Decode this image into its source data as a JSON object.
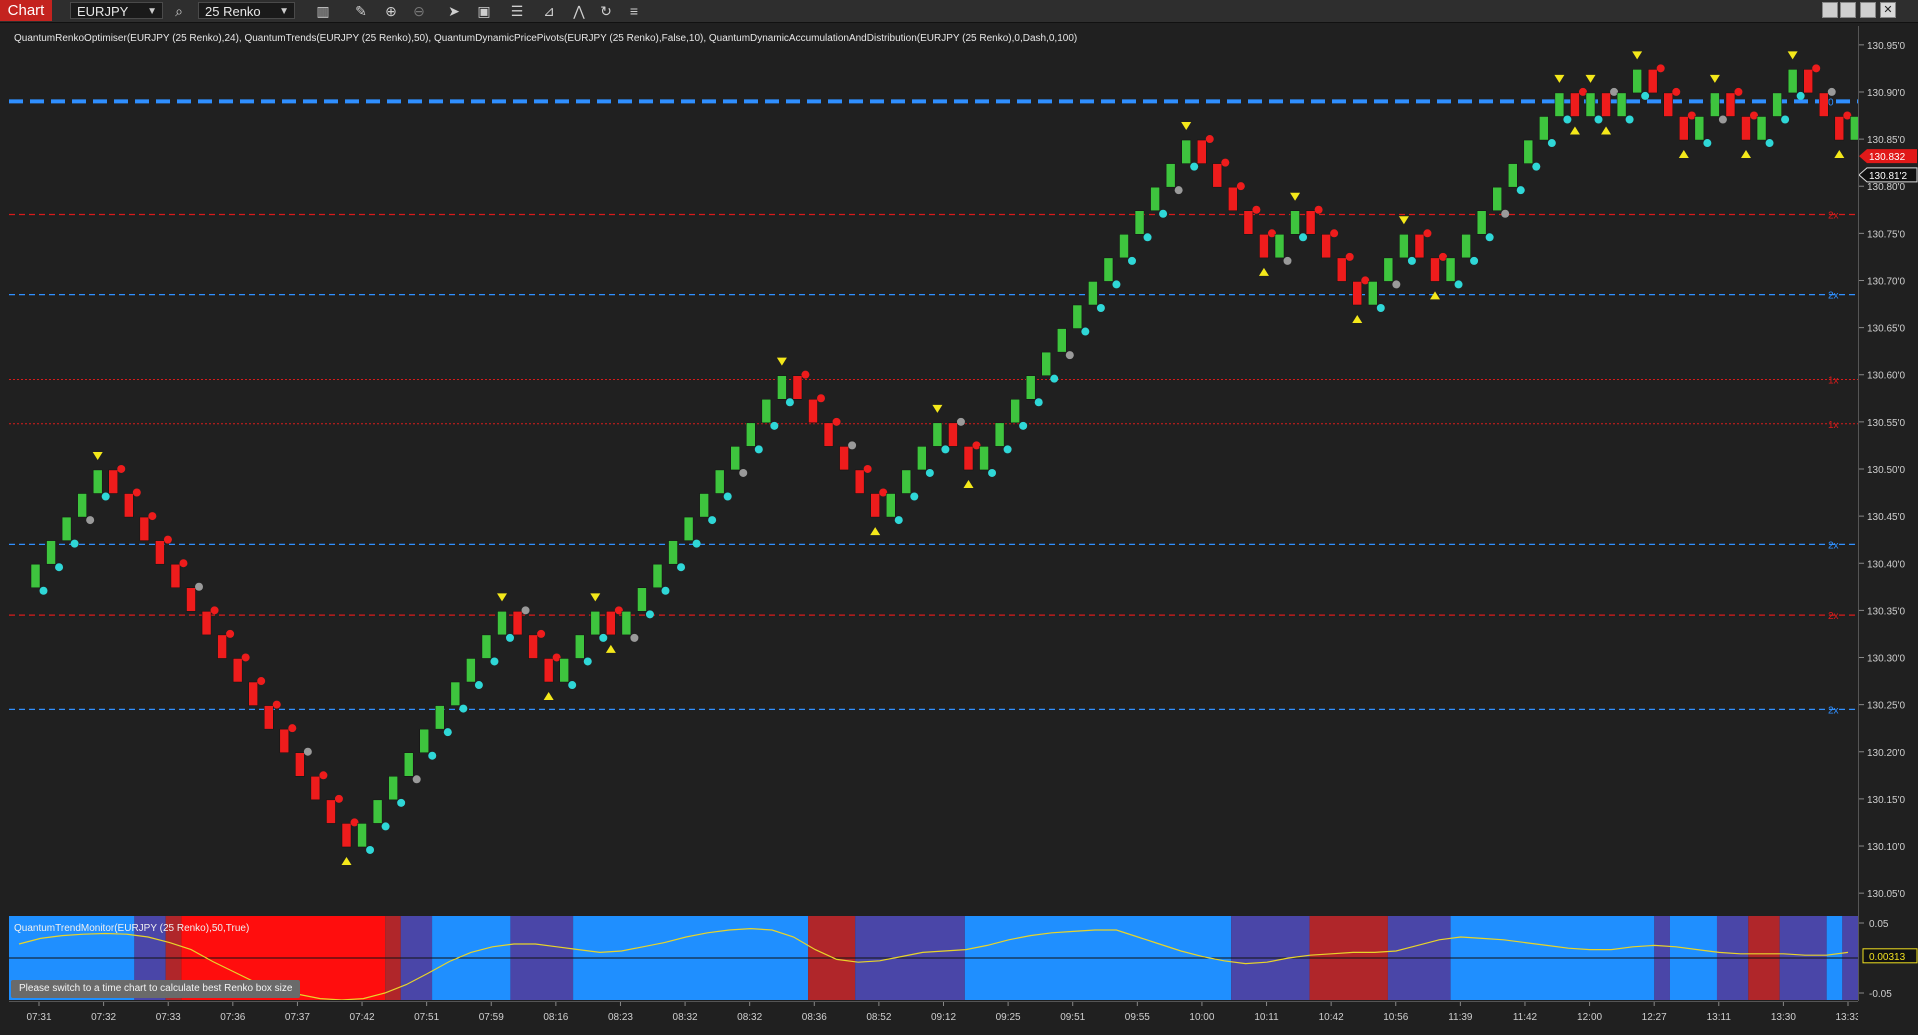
{
  "toolbar": {
    "chart_tab": "Chart",
    "symbol": "EURJPY",
    "bar_type": "25 Renko",
    "icons": [
      "search-icon",
      "bar-style-icon",
      "pencil-icon",
      "zoom-in-icon",
      "zoom-out-icon",
      "cursor-icon",
      "properties-icon",
      "strategy-icon",
      "indicators-icon",
      "drawing-tools-icon",
      "refresh-icon",
      "list-icon"
    ]
  },
  "window_buttons": [
    "minimize-icon",
    "restore-icon",
    "maximize-icon",
    "close-icon"
  ],
  "indicators_label": "QuantumRenkoOptimiser(EURJPY (25 Renko),24), QuantumTrends(EURJPY (25 Renko),50), QuantumDynamicPricePivots(EURJPY (25 Renko),False,10), QuantumDynamicAccumulationAndDistribution(EURJPY (25 Renko),0,Dash,0,100)",
  "oscillator_label": "QuantumTrendMonitor(EURJPY (25 Renko),50,True)",
  "notice": "Please switch to a time chart to calculate best Renko box size",
  "price_axis": {
    "ticks": [
      "130.95'0",
      "130.90'0",
      "130.85'0",
      "130.80'0",
      "130.75'0",
      "130.70'0",
      "130.65'0",
      "130.60'0",
      "130.55'0",
      "130.50'0",
      "130.45'0",
      "130.40'0",
      "130.35'0",
      "130.30'0",
      "130.25'0",
      "130.20'0",
      "130.15'0",
      "130.10'0",
      "130.05'0"
    ],
    "current_price": "130.832",
    "last_price": "130.81'2"
  },
  "osc_axis": {
    "ticks": [
      "0.05",
      "-0.05"
    ],
    "value": "0.00313"
  },
  "time_axis": [
    "07:31",
    "07:32",
    "07:33",
    "07:36",
    "07:37",
    "07:42",
    "07:51",
    "07:59",
    "08:16",
    "08:23",
    "08:32",
    "08:32",
    "08:36",
    "08:52",
    "09:12",
    "09:25",
    "09:51",
    "09:55",
    "10:00",
    "10:11",
    "10:42",
    "10:56",
    "11:39",
    "11:42",
    "12:00",
    "12:27",
    "13:11",
    "13:30",
    "13:33"
  ],
  "level_labels": {
    "blue_major": "0",
    "red_2x": "2x",
    "blue_2x": "2x",
    "red_1x": "1x"
  },
  "colors": {
    "up": "#3ec43e",
    "down": "#ee1c1c",
    "blue_line": "#2f8fff",
    "red_line": "#d81b1b",
    "pivot": "#f4e81a",
    "cyan": "#2fd7d7",
    "gray": "#9a9a9a"
  },
  "chart_data": {
    "type": "renko",
    "box_size": 0.025,
    "closes": [
      130.399,
      130.424,
      130.449,
      130.474,
      130.499,
      130.474,
      130.449,
      130.424,
      130.399,
      130.374,
      130.349,
      130.324,
      130.299,
      130.274,
      130.249,
      130.224,
      130.199,
      130.174,
      130.149,
      130.124,
      130.099,
      130.124,
      130.149,
      130.174,
      130.199,
      130.224,
      130.249,
      130.274,
      130.299,
      130.324,
      130.349,
      130.324,
      130.299,
      130.274,
      130.299,
      130.324,
      130.349,
      130.324,
      130.349,
      130.374,
      130.399,
      130.424,
      130.449,
      130.474,
      130.499,
      130.524,
      130.549,
      130.574,
      130.599,
      130.574,
      130.549,
      130.524,
      130.499,
      130.474,
      130.449,
      130.474,
      130.499,
      130.524,
      130.549,
      130.524,
      130.499,
      130.524,
      130.549,
      130.574,
      130.599,
      130.624,
      130.649,
      130.674,
      130.699,
      130.724,
      130.749,
      130.774,
      130.799,
      130.824,
      130.849,
      130.824,
      130.799,
      130.774,
      130.749,
      130.724,
      130.749,
      130.774,
      130.749,
      130.724,
      130.699,
      130.674,
      130.699,
      130.724,
      130.749,
      130.724,
      130.699,
      130.724,
      130.749,
      130.774,
      130.799,
      130.824,
      130.849,
      130.874,
      130.899,
      130.874,
      130.899,
      130.874,
      130.899,
      130.924,
      130.899,
      130.874,
      130.849,
      130.874,
      130.899,
      130.874,
      130.849,
      130.874,
      130.899,
      130.924,
      130.899,
      130.874,
      130.849,
      130.874,
      130.899,
      130.874,
      130.849,
      130.874,
      130.899,
      130.924,
      130.899,
      130.874,
      130.849,
      130.824
    ],
    "levels": [
      {
        "price": 130.89,
        "color": "blue",
        "style": "thick-dash",
        "label": "0"
      },
      {
        "price": 130.77,
        "color": "red",
        "style": "dash",
        "label": "2x"
      },
      {
        "price": 130.685,
        "color": "blue",
        "style": "dash",
        "label": "2x"
      },
      {
        "price": 130.595,
        "color": "red",
        "style": "dot",
        "label": "1x"
      },
      {
        "price": 130.548,
        "color": "red",
        "style": "dot",
        "label": "1x"
      },
      {
        "price": 130.42,
        "color": "blue",
        "style": "dash",
        "label": "2x"
      },
      {
        "price": 130.345,
        "color": "red",
        "style": "dash",
        "label": "2x"
      },
      {
        "price": 130.245,
        "color": "blue",
        "style": "dash",
        "label": "2x"
      }
    ],
    "ylim": [
      130.03,
      130.97
    ],
    "oscillator": {
      "ylim": [
        -0.06,
        0.06
      ],
      "bands": [
        {
          "from": 0,
          "to": 8,
          "color": "#1f8fff"
        },
        {
          "from": 8,
          "to": 10,
          "color": "#4a46a8"
        },
        {
          "from": 10,
          "to": 11,
          "color": "#b0262a"
        },
        {
          "from": 11,
          "to": 24,
          "color": "#ff0d0d"
        },
        {
          "from": 24,
          "to": 25,
          "color": "#b0262a"
        },
        {
          "from": 25,
          "to": 27,
          "color": "#4a46a8"
        },
        {
          "from": 27,
          "to": 32,
          "color": "#1f8fff"
        },
        {
          "from": 32,
          "to": 36,
          "color": "#4a46a8"
        },
        {
          "from": 36,
          "to": 51,
          "color": "#1f8fff"
        },
        {
          "from": 51,
          "to": 54,
          "color": "#b0262a"
        },
        {
          "from": 54,
          "to": 61,
          "color": "#4a46a8"
        },
        {
          "from": 61,
          "to": 78,
          "color": "#1f8fff"
        },
        {
          "from": 78,
          "to": 83,
          "color": "#4a46a8"
        },
        {
          "from": 83,
          "to": 88,
          "color": "#b0262a"
        },
        {
          "from": 88,
          "to": 92,
          "color": "#4a46a8"
        },
        {
          "from": 92,
          "to": 105,
          "color": "#1f8fff"
        },
        {
          "from": 105,
          "to": 106,
          "color": "#4a46a8"
        },
        {
          "from": 106,
          "to": 109,
          "color": "#1f8fff"
        },
        {
          "from": 109,
          "to": 111,
          "color": "#4a46a8"
        },
        {
          "from": 111,
          "to": 113,
          "color": "#b0262a"
        },
        {
          "from": 113,
          "to": 116,
          "color": "#4a46a8"
        },
        {
          "from": 116,
          "to": 117,
          "color": "#1f8fff"
        },
        {
          "from": 117,
          "to": 118,
          "color": "#4a46a8"
        }
      ],
      "values": [
        0.02,
        0.028,
        0.032,
        0.034,
        0.035,
        0.034,
        0.03,
        0.022,
        0.012,
        -0.005,
        -0.02,
        -0.035,
        -0.045,
        -0.052,
        -0.058,
        -0.06,
        -0.058,
        -0.05,
        -0.038,
        -0.022,
        -0.005,
        0.008,
        0.016,
        0.02,
        0.02,
        0.016,
        0.012,
        0.008,
        0.01,
        0.016,
        0.022,
        0.03,
        0.036,
        0.04,
        0.042,
        0.04,
        0.03,
        0.012,
        -0.002,
        -0.006,
        -0.004,
        0.002,
        0.008,
        0.01,
        0.012,
        0.018,
        0.026,
        0.032,
        0.036,
        0.038,
        0.04,
        0.04,
        0.03,
        0.02,
        0.01,
        0.002,
        -0.004,
        -0.008,
        -0.006,
        0.0,
        0.004,
        0.006,
        0.008,
        0.008,
        0.01,
        0.018,
        0.026,
        0.03,
        0.028,
        0.026,
        0.022,
        0.018,
        0.014,
        0.012,
        0.012,
        0.016,
        0.018,
        0.016,
        0.012,
        0.008,
        0.006,
        0.006,
        0.006,
        0.004,
        0.004,
        0.008
      ]
    }
  }
}
